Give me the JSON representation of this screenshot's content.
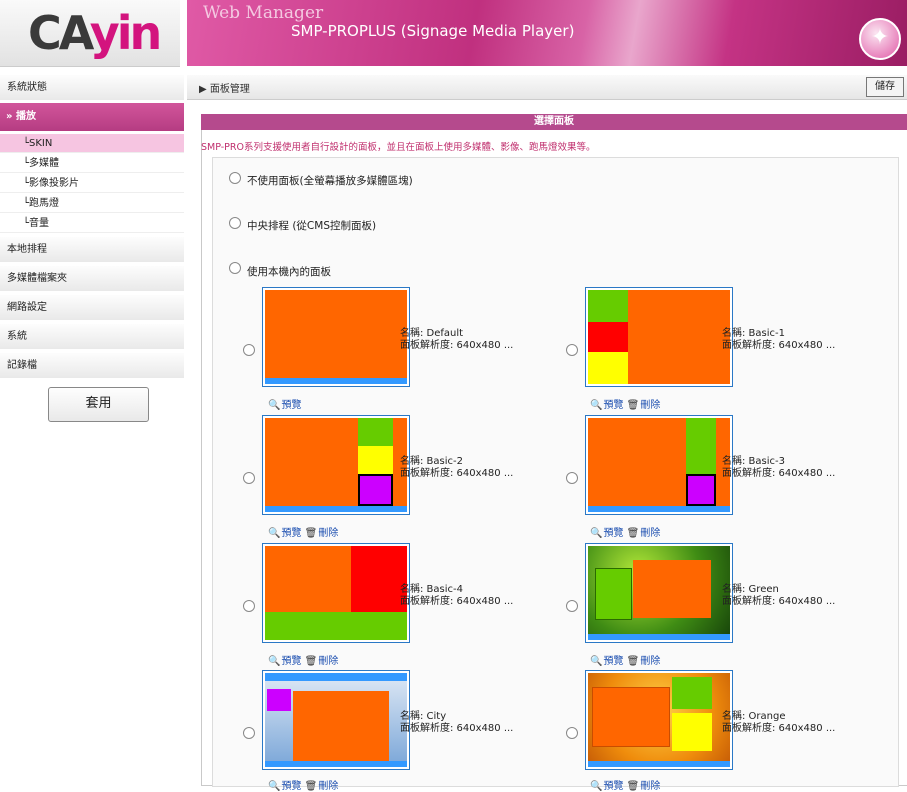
{
  "logo": {
    "text_a": "CA",
    "text_b": "yin"
  },
  "header": {
    "subtitle": "Web Manager",
    "title": "SMP-PROPLUS (Signage Media Player)"
  },
  "sidebar": {
    "items_top": [
      "系統狀態"
    ],
    "play_label": "播放",
    "sub_items": [
      "SKIN",
      "多媒體",
      "影像投影片",
      "跑馬燈",
      "音量"
    ],
    "items_bottom": [
      "本地排程",
      "多媒體檔案夾",
      "網路設定",
      "系統",
      "記錄檔"
    ],
    "apply_label": "套用"
  },
  "main": {
    "breadcrumb": "面板管理",
    "save_label": "儲存",
    "panel_title": "選擇面板",
    "description": "SMP-PRO系列支援使用者自行設計的面板，並且在面板上使用多媒體、影像、跑馬燈效果等。",
    "options": [
      "不使用面板(全螢幕播放多媒體區塊)",
      "中央排程 (從CMS控制面板)",
      "使用本機內的面板"
    ],
    "preview_label": "預覽",
    "delete_label": "刪除",
    "skins": [
      {
        "name": "名稱: Default",
        "res": "面板解析度: 640x480 ..."
      },
      {
        "name": "名稱: Basic-1",
        "res": "面板解析度: 640x480 ..."
      },
      {
        "name": "名稱: Basic-2",
        "res": "面板解析度: 640x480 ..."
      },
      {
        "name": "名稱: Basic-3",
        "res": "面板解析度: 640x480 ..."
      },
      {
        "name": "名稱: Basic-4",
        "res": "面板解析度: 640x480 ..."
      },
      {
        "name": "名稱: Green",
        "res": "面板解析度: 640x480 ..."
      },
      {
        "name": "名稱: City",
        "res": "面板解析度: 640x480 ..."
      },
      {
        "name": "名稱: Orange",
        "res": "面板解析度: 640x480 ..."
      }
    ]
  },
  "colors": {
    "accent": "#b54a8d",
    "orange": "#ff6600",
    "blue": "#3399ff",
    "green": "#66cc00",
    "red": "#ff0000",
    "yellow": "#ffff00",
    "purple": "#cc00ff"
  }
}
